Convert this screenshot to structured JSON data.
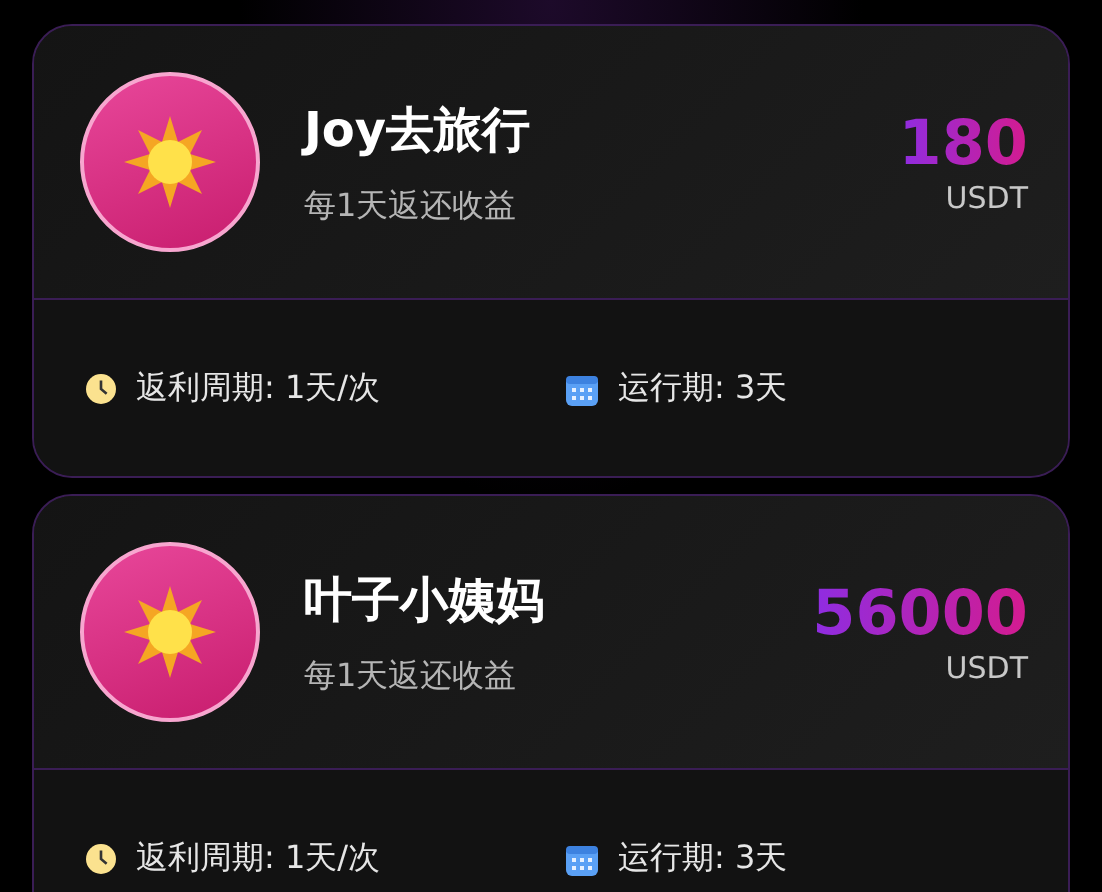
{
  "plans": [
    {
      "name": "Joy去旅行",
      "subtitle": "每1天返还收益",
      "amount": "180",
      "currency": "USDT",
      "cycle": "返利周期: 1天/次",
      "period": "运行期: 3天"
    },
    {
      "name": "叶子小姨妈",
      "subtitle": "每1天返还收益",
      "amount": "56000",
      "currency": "USDT",
      "cycle": "返利周期: 1天/次",
      "period": "运行期: 3天"
    }
  ]
}
